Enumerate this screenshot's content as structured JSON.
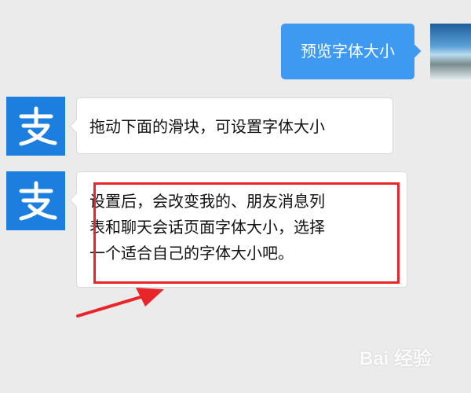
{
  "messages": {
    "outgoing": {
      "text": "预览字体大小"
    },
    "incoming": [
      {
        "text": "拖动下面的滑块，可设置字体大小"
      },
      {
        "lines": [
          "设置后，会改变我的、朋友消息列",
          "表和聊天会话页面字体大小，选择",
          "一个适合自己的字体大小吧。"
        ]
      }
    ]
  },
  "avatars": {
    "sender": "alipay-logo",
    "user": "landscape-photo"
  },
  "annotations": {
    "highlight_color": "#e8262a"
  },
  "watermark": {
    "text": "Bai 经验"
  },
  "colors": {
    "background": "#ebebeb",
    "outgoing_bubble": "#3d9af0",
    "alipay_blue": "#1c7fe0"
  }
}
